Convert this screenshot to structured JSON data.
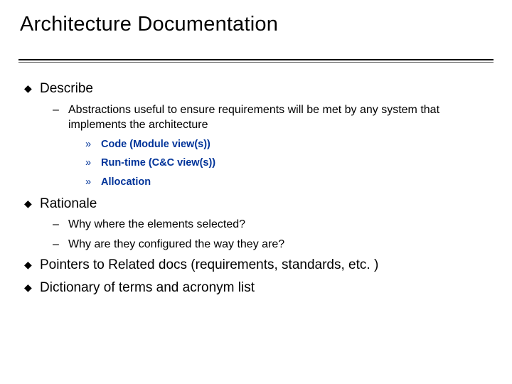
{
  "title": "Architecture Documentation",
  "items": {
    "i0": {
      "label": "Describe",
      "sub": {
        "s0": {
          "label": "Abstractions useful to ensure requirements will be met by any system that implements the architecture",
          "sub": {
            "t0": "Code (Module view(s))",
            "t1": "Run-time (C&C view(s))",
            "t2": "Allocation"
          }
        }
      }
    },
    "i1": {
      "label": "Rationale",
      "sub": {
        "s0": {
          "label": "Why where the elements selected?"
        },
        "s1": {
          "label": "Why are they configured the way they are?"
        }
      }
    },
    "i2": {
      "label": "Pointers to Related docs (requirements, standards, etc. )"
    },
    "i3": {
      "label": "Dictionary of terms and acronym list"
    }
  }
}
